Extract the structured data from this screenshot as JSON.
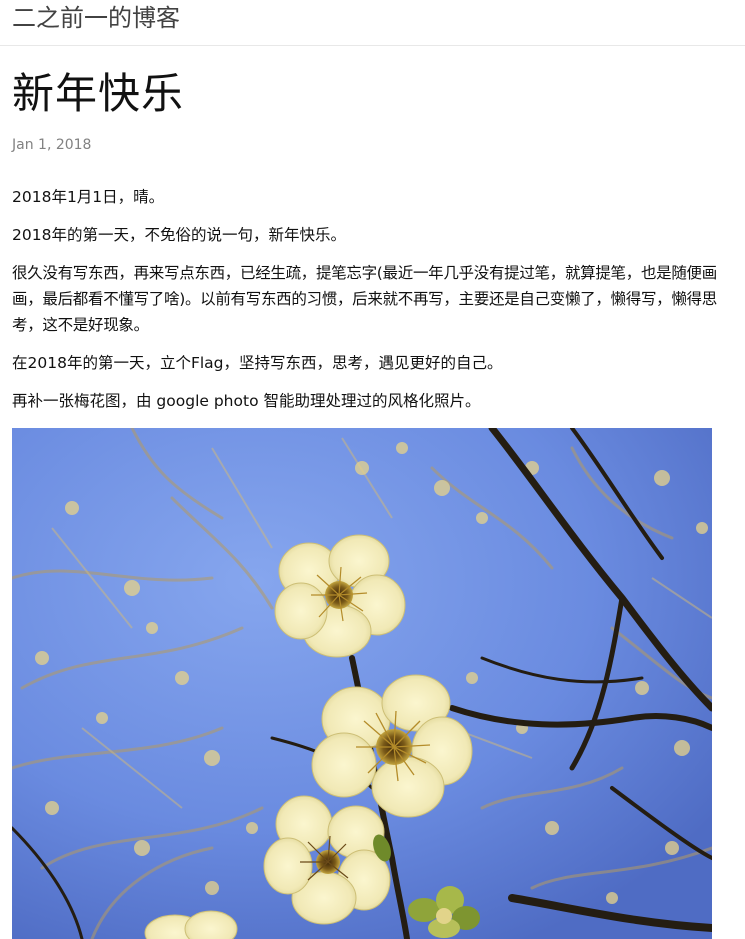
{
  "header": {
    "site_title": "二之前一的博客"
  },
  "post": {
    "title": "新年快乐",
    "date": "Jan 1, 2018",
    "paragraphs": [
      "2018年1月1日，晴。",
      "2018年的第一天，不免俗的说一句，新年快乐。",
      "很久没有写东西，再来写点东西，已经生疏，提笔忘字(最近一年几乎没有提过笔，就算提笔，也是随便画画，最后都看不懂写了啥)。以前有写东西的习惯，后来就不再写，主要还是自己变懒了，懒得写，懒得思考，这不是好现象。",
      "在2018年的第一天，立个Flag，坚持写东西，思考，遇见更好的自己。",
      "再补一张梅花图，由 google photo 智能助理处理过的风格化照片。"
    ],
    "photo": {
      "subject": "plum-blossom-photo",
      "colors": {
        "sky": "#6f8fe0",
        "branch": "#2a2418",
        "petal": "#f4efc4",
        "center": "#5a3a10",
        "bud": "#d9c27a"
      }
    }
  }
}
